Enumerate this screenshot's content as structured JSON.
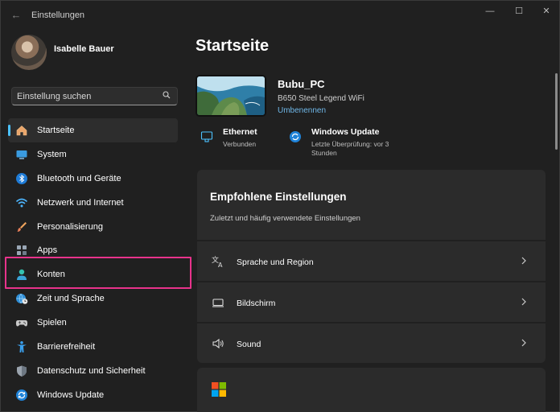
{
  "app": {
    "title": "Einstellungen"
  },
  "profile": {
    "name": "Isabelle Bauer"
  },
  "search": {
    "placeholder": "Einstellung suchen"
  },
  "nav": {
    "items": [
      {
        "label": "Startseite",
        "icon": "home-icon",
        "active": true
      },
      {
        "label": "System",
        "icon": "monitor-icon"
      },
      {
        "label": "Bluetooth und Geräte",
        "icon": "bluetooth-icon"
      },
      {
        "label": "Netzwerk und Internet",
        "icon": "wifi-icon"
      },
      {
        "label": "Personalisierung",
        "icon": "paintbrush-icon"
      },
      {
        "label": "Apps",
        "icon": "apps-icon"
      },
      {
        "label": "Konten",
        "icon": "person-icon",
        "highlighted": true
      },
      {
        "label": "Zeit und Sprache",
        "icon": "globe-clock-icon"
      },
      {
        "label": "Spielen",
        "icon": "gamepad-icon"
      },
      {
        "label": "Barrierefreiheit",
        "icon": "accessibility-icon"
      },
      {
        "label": "Datenschutz und Sicherheit",
        "icon": "shield-icon"
      },
      {
        "label": "Windows Update",
        "icon": "windows-update-icon"
      }
    ]
  },
  "main": {
    "title": "Startseite",
    "device": {
      "name": "Bubu_PC",
      "model": "B650 Steel Legend WiFi",
      "rename": "Umbenennen"
    },
    "status": [
      {
        "title": "Ethernet",
        "sub": "Verbunden",
        "icon": "ethernet-icon"
      },
      {
        "title": "Windows Update",
        "sub": "Letzte Überprüfung: vor 3 Stunden",
        "icon": "sync-icon"
      }
    ],
    "recommended": {
      "title": "Empfohlene Einstellungen",
      "subtitle": "Zuletzt und häufig verwendete Einstellungen",
      "rows": [
        {
          "label": "Sprache und Region",
          "icon": "language-icon"
        },
        {
          "label": "Bildschirm",
          "icon": "display-icon"
        },
        {
          "label": "Sound",
          "icon": "speaker-icon"
        }
      ]
    }
  },
  "colors": {
    "accent": "#4cc2ff",
    "highlight": "#e8338b",
    "link": "#6fb7e8"
  }
}
